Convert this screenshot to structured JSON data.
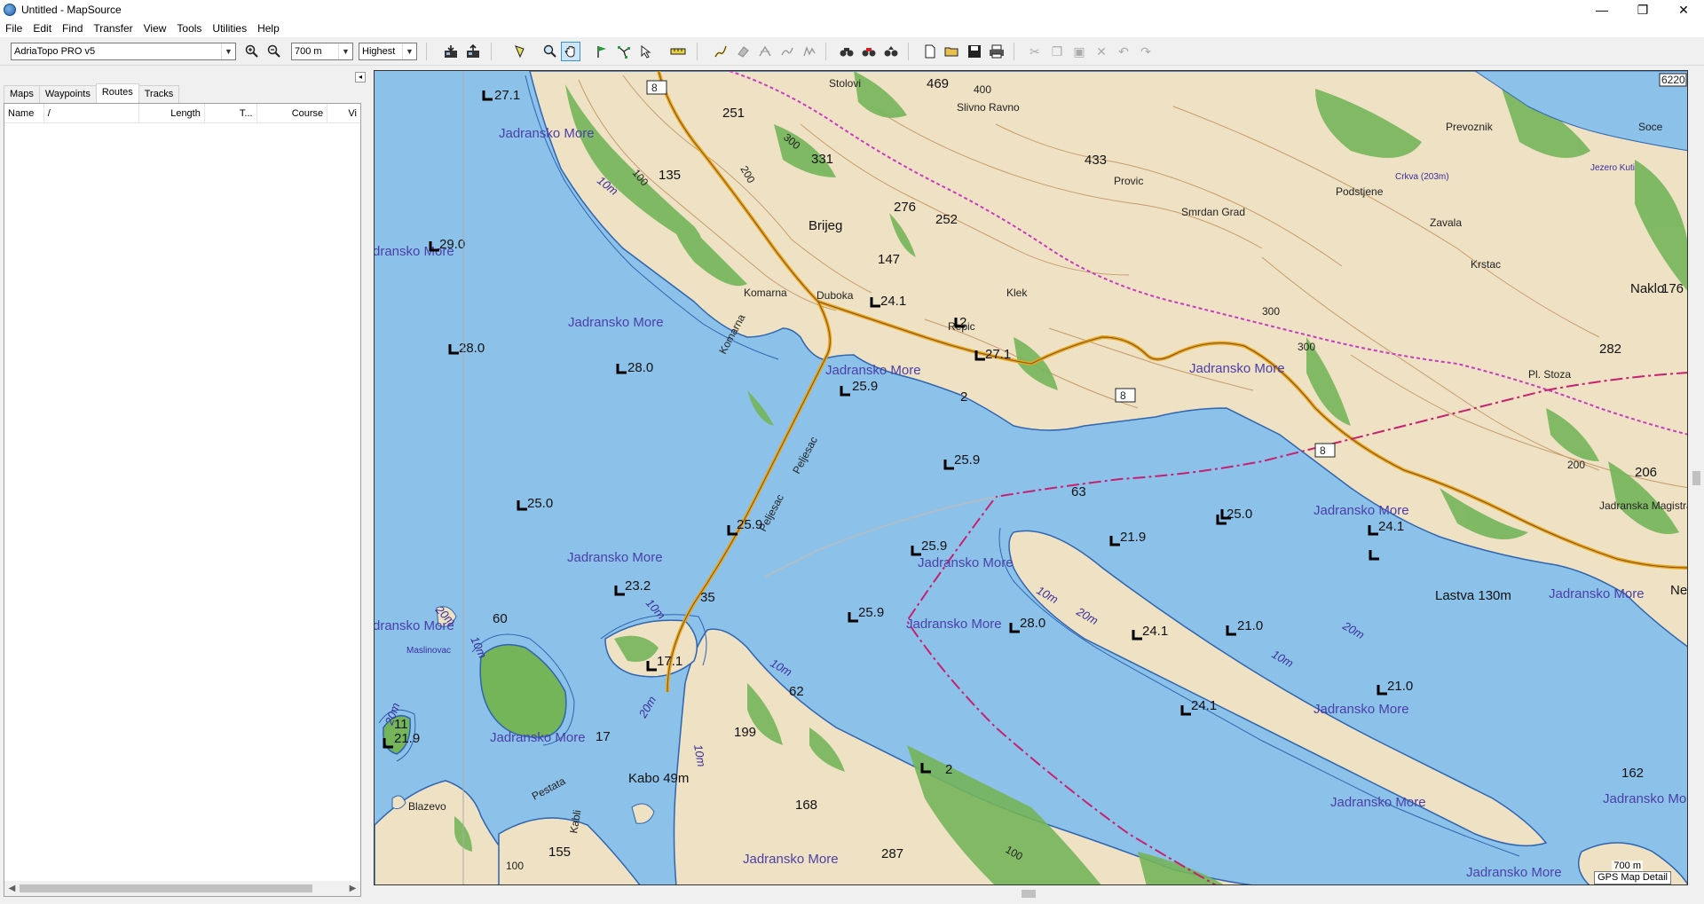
{
  "window": {
    "title": "Untitled - MapSource",
    "controls": {
      "minimize": "—",
      "maximize": "❐",
      "close": "✕"
    }
  },
  "menu": [
    "File",
    "Edit",
    "Find",
    "Transfer",
    "View",
    "Tools",
    "Utilities",
    "Help"
  ],
  "toolbar": {
    "product_select": "AdriaTopo PRO v5",
    "zoom_select": "700 m",
    "detail_select": "Highest",
    "icons": [
      "zoom-in-icon",
      "zoom-out-icon",
      "receive-from-device-icon",
      "send-to-device-icon",
      "map-tool-icon",
      "zoom-tool-icon",
      "pan-tool-icon",
      "waypoint-tool-icon",
      "route-tool-icon",
      "selection-tool-icon",
      "measure-tool-icon",
      "track-tool-icon",
      "erase-tool-icon",
      "divide-tool-icon",
      "join-tool-icon",
      "simplify-tool-icon",
      "find-icon",
      "find-nearest-icon",
      "find-address-icon",
      "new-icon",
      "open-icon",
      "save-icon",
      "print-icon",
      "cut-icon",
      "copy-icon",
      "paste-icon",
      "delete-icon",
      "undo-icon",
      "redo-icon"
    ]
  },
  "left_panel": {
    "tabs": [
      "Maps",
      "Waypoints",
      "Routes",
      "Tracks"
    ],
    "active_tab": "Routes",
    "columns": [
      "Name",
      "/",
      "Length",
      "T...",
      "Course",
      "Vi"
    ]
  },
  "map": {
    "sea_labels": [
      "Jadransko More",
      "dransko More",
      "Jadransko More",
      "Jadransko More",
      "Jadransko More",
      "Jadransko More",
      "Jadransko More",
      "Jadransko More",
      "Jadransko More",
      "Jadransko More",
      "dransko More",
      "Jadransko More",
      "Jadransko More",
      "Jadransko More",
      "Jadransko More",
      "Jadransko More",
      "Jadransko More",
      "Jadransko More"
    ],
    "place_labels": [
      "Stolovi",
      "Slivno Ravno",
      "Prevoznik",
      "Soce",
      "Jezero Kuti",
      "Crkva (203m)",
      "Provic",
      "Smrdan Grad",
      "Podstjene",
      "Zavala",
      "Krstac",
      "Naklo",
      "Brijeg",
      "Komarna",
      "Duboka",
      "Klek",
      "Repic",
      "Pl. Stoza",
      "Jadranska Magistrala",
      "Lastva 130m",
      "Neu",
      "Maslinovac",
      "Kabo 49m",
      "Blazevo",
      "Pestata",
      "Kabli",
      "Peljesac",
      "Peljesac",
      "Komarna"
    ],
    "elevations": [
      "469",
      "400",
      "251",
      "300",
      "331",
      "200",
      "135",
      "100",
      "276",
      "252",
      "433",
      "147",
      "176",
      "300",
      "300",
      "282",
      "200",
      "206",
      "63",
      "60",
      "35",
      "62",
      "199",
      "168",
      "287",
      "155",
      "100",
      "100",
      "162",
      "17",
      "11",
      "2"
    ],
    "depth_soundings": [
      "27.1",
      "29.0",
      "28.0",
      "28.0",
      "24.1",
      "2",
      "27.1",
      "25.9",
      "25.9",
      "25.0",
      "25.0",
      "25.9",
      "25.9",
      "21.9",
      "25.0",
      "24.1",
      "23.2",
      "17.1",
      "25.9",
      "28.0",
      "24.1",
      "21.0",
      "21.0",
      "24.1",
      "21.9",
      "2"
    ],
    "depth_contours": [
      "10m",
      "20m",
      "10m",
      "20m",
      "10m",
      "20m",
      "10m",
      "10m",
      "20m",
      "10m",
      "20m",
      "10m"
    ],
    "road_shields": [
      "8",
      "8",
      "8",
      "6220"
    ],
    "scale": "700 m",
    "map_detail": "GPS Map Detail"
  }
}
